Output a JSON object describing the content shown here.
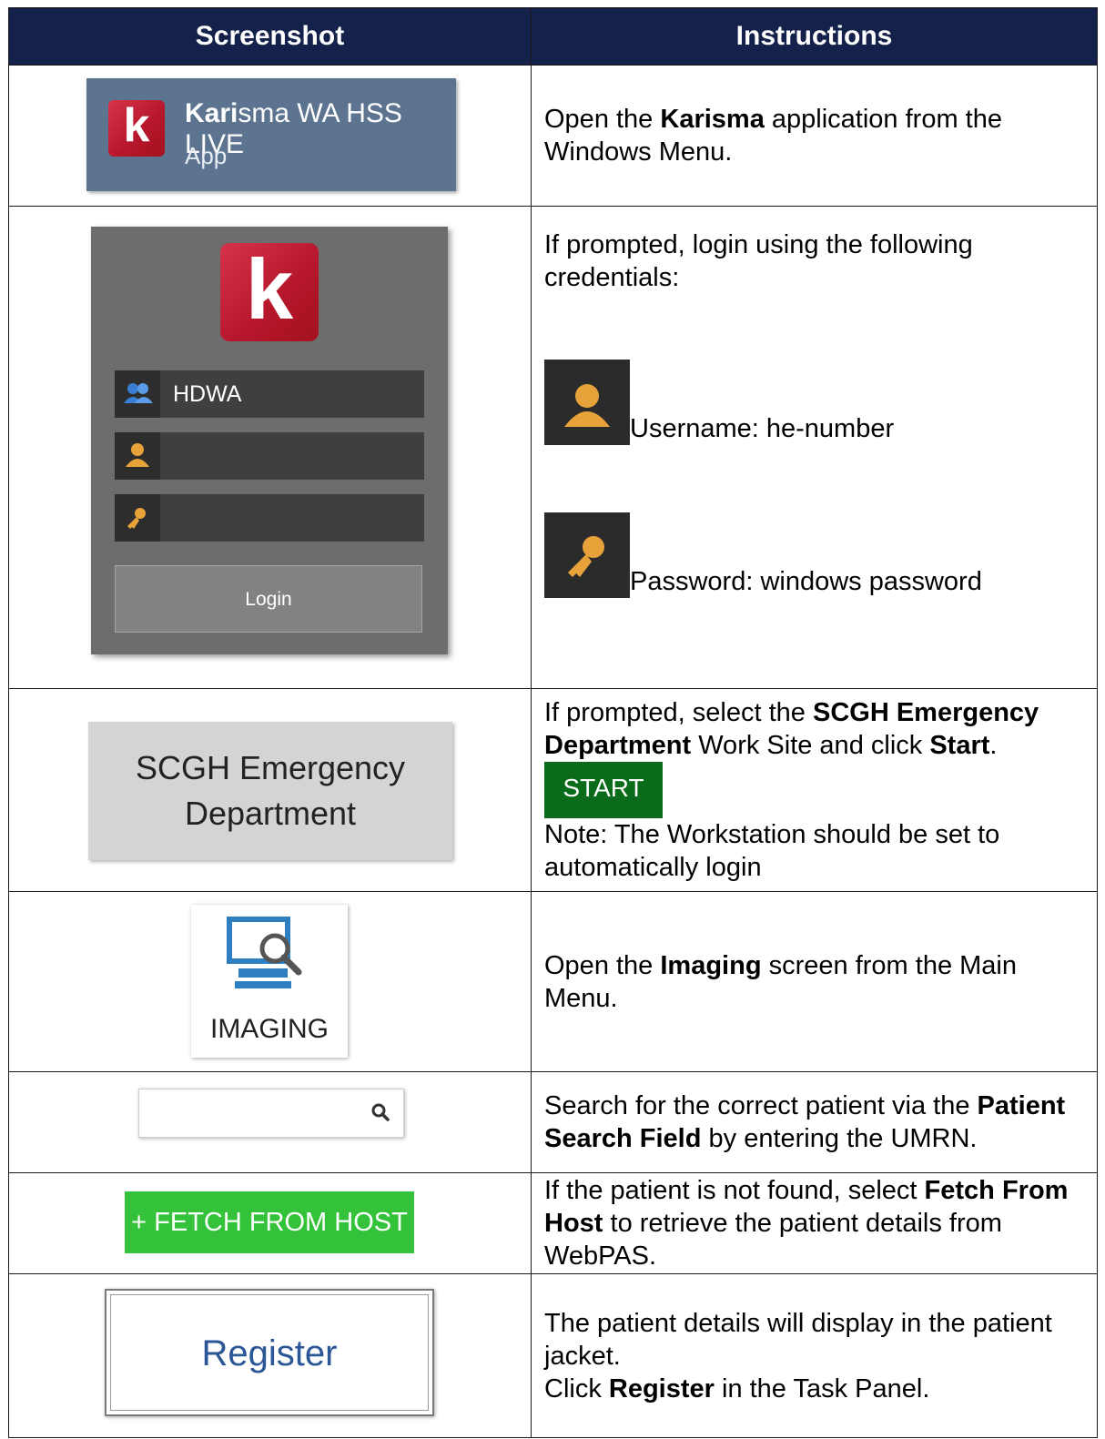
{
  "table": {
    "headers": [
      "Screenshot",
      "Instructions"
    ]
  },
  "rows": {
    "open_app": {
      "tile_title_bold": "Kari",
      "tile_title_rest": "sma WA HSS LIVE",
      "tile_sub": "App",
      "logo_letter": "k",
      "t1": "Open the ",
      "b1": "Karisma",
      "t2": " application from the Windows Menu."
    },
    "login": {
      "logo_letter": "k",
      "site_value": "HDWA",
      "login_button": "Login",
      "text": "If prompted, login using the following credentials:",
      "username_line": "Username: he-number",
      "password_line": "Password: windows password"
    },
    "worksite": {
      "tile_line1": "SCGH Emergency",
      "tile_line2": "Department",
      "t1": "If prompted, select the ",
      "b1": "SCGH Emergency Department",
      "t2": " Work Site and click ",
      "b2": "Start",
      "t3": ".",
      "start_button": "START",
      "note": "Note: The Workstation should be set to automatically login"
    },
    "imaging": {
      "tile_label": "IMAGING",
      "t1": "Open the ",
      "b1": "Imaging",
      "t2": " screen from the Main Menu."
    },
    "search": {
      "t1": "Search for the correct patient via the ",
      "b1": "Patient Search Field",
      "t2": " by entering the UMRN."
    },
    "fetch": {
      "button": "+ FETCH FROM HOST",
      "t1": "If the patient is not found, select ",
      "b1": "Fetch From Host",
      "t2": " to retrieve the patient details from WebPAS."
    },
    "register": {
      "button": "Register",
      "t1": "The patient details will display in the patient jacket.",
      "t2": "Click ",
      "b1": "Register",
      "t3": " in the Task Panel."
    }
  },
  "colors": {
    "header_bg": "#14214a",
    "karisma_red": "#b5162b",
    "start_green": "#0a6b1a",
    "fetch_green": "#35c23b",
    "register_blue": "#2b5797",
    "icon_orange": "#e8a23a"
  },
  "icons": [
    "group-icon",
    "user-icon",
    "key-icon",
    "imaging-monitor-icon",
    "search-icon"
  ]
}
